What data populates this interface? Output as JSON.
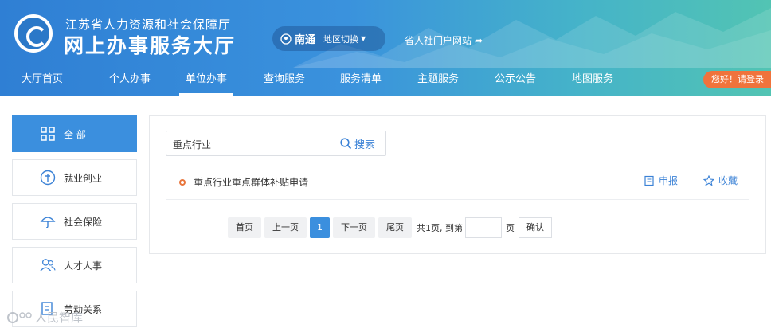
{
  "header": {
    "subtitle": "江苏省人力资源和社会保障厅",
    "title": "网上办事服务大厅",
    "city": "南通",
    "region_switch": "地区切换",
    "portal_link": "省人社门户网站"
  },
  "nav": {
    "items": [
      "大厅首页",
      "个人办事",
      "单位办事",
      "查询服务",
      "服务清单",
      "主题服务",
      "公示公告",
      "地图服务"
    ],
    "active": "单位办事",
    "login": "您好！请登录"
  },
  "sidebar": {
    "items": [
      {
        "label": "全 部",
        "icon": "grid-icon"
      },
      {
        "label": "就业创业",
        "icon": "employment-icon"
      },
      {
        "label": "社会保险",
        "icon": "umbrella-icon"
      },
      {
        "label": "人才人事",
        "icon": "people-icon"
      },
      {
        "label": "劳动关系",
        "icon": "labor-icon"
      }
    ]
  },
  "search": {
    "value": "重点行业",
    "button": "搜索"
  },
  "results": [
    {
      "title": "重点行业重点群体补贴申请",
      "apply": "申报",
      "favorite": "收藏"
    }
  ],
  "pager": {
    "first": "首页",
    "prev": "上一页",
    "current": "1",
    "next": "下一页",
    "last": "尾页",
    "info": "共1页, 到第",
    "page_unit": "页",
    "confirm": "确认"
  },
  "watermark": "人民智库",
  "colors": {
    "primary": "#3b8fde",
    "accent": "#f0733c",
    "link": "#3b82d6"
  }
}
